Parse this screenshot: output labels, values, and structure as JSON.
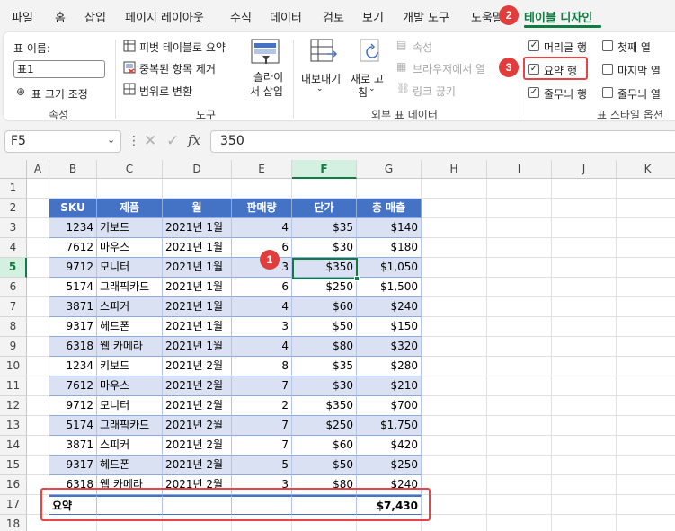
{
  "menu": {
    "tabs": [
      "파일",
      "홈",
      "삽입",
      "페이지 레이아웃",
      "수식",
      "데이터",
      "검토",
      "보기",
      "개발 도구",
      "도움말",
      "테이블 디자인"
    ],
    "active_tab": "테이블 디자인"
  },
  "ribbon": {
    "properties": {
      "table_name_label": "표 이름:",
      "table_name_value": "표1",
      "resize_label": "표 크기 조정",
      "group_label": "속성"
    },
    "tools": {
      "pivot_label": "피벗 테이블로 요약",
      "remove_duplicates_label": "중복된 항목 제거",
      "convert_range_label": "범위로 변환",
      "slicer_label_line1": "슬라이",
      "slicer_label_line2": "서 삽입",
      "group_label": "도구"
    },
    "external": {
      "export_label": "내보내기",
      "refresh_label_line1": "새로 고",
      "refresh_label_line2": "침",
      "properties_label": "속성",
      "open_browser_label": "브라우저에서 열",
      "unlink_label": "링크 끊기",
      "group_label": "외부 표 데이터"
    },
    "style_options": {
      "header_row_label": "머리글 행",
      "header_row_checked": true,
      "total_row_label": "요약 행",
      "total_row_checked": true,
      "banded_rows_label": "줄무늬 행",
      "banded_rows_checked": true,
      "first_col_label": "첫째 열",
      "first_col_checked": false,
      "last_col_label": "마지막 열",
      "last_col_checked": false,
      "banded_cols_label": "줄무늬 열",
      "banded_cols_checked": false,
      "group_label": "표 스타일 옵션"
    }
  },
  "formula_bar": {
    "name_box": "F5",
    "fx_label": "fx",
    "value": "350"
  },
  "sheet": {
    "columns": [
      "A",
      "B",
      "C",
      "D",
      "E",
      "F",
      "G",
      "H",
      "I",
      "J",
      "K"
    ],
    "selected_column": "F",
    "rows": [
      "1",
      "2",
      "3",
      "4",
      "5",
      "6",
      "7",
      "8",
      "9",
      "10",
      "11",
      "12",
      "13",
      "14",
      "15",
      "16",
      "17",
      "18"
    ],
    "selected_row": "5"
  },
  "table": {
    "headers": [
      "SKU",
      "제품",
      "월",
      "판매량",
      "단가",
      "총 매출"
    ],
    "rows": [
      [
        "1234",
        "키보드",
        "2021년 1월",
        "4",
        "$35",
        "$140"
      ],
      [
        "7612",
        "마우스",
        "2021년 1월",
        "6",
        "$30",
        "$180"
      ],
      [
        "9712",
        "모니터",
        "2021년 1월",
        "3",
        "$350",
        "$1,050"
      ],
      [
        "5174",
        "그래픽카드",
        "2021년 1월",
        "6",
        "$250",
        "$1,500"
      ],
      [
        "3871",
        "스피커",
        "2021년 1월",
        "4",
        "$60",
        "$240"
      ],
      [
        "9317",
        "헤드폰",
        "2021년 1월",
        "3",
        "$50",
        "$150"
      ],
      [
        "6318",
        "웹 카메라",
        "2021년 1월",
        "4",
        "$80",
        "$320"
      ],
      [
        "1234",
        "키보드",
        "2021년 2월",
        "8",
        "$35",
        "$280"
      ],
      [
        "7612",
        "마우스",
        "2021년 2월",
        "7",
        "$30",
        "$210"
      ],
      [
        "9712",
        "모니터",
        "2021년 2월",
        "2",
        "$350",
        "$700"
      ],
      [
        "5174",
        "그래픽카드",
        "2021년 2월",
        "7",
        "$250",
        "$1,750"
      ],
      [
        "3871",
        "스피커",
        "2021년 2월",
        "7",
        "$60",
        "$420"
      ],
      [
        "9317",
        "헤드폰",
        "2021년 2월",
        "5",
        "$50",
        "$250"
      ],
      [
        "6318",
        "웹 카메라",
        "2021년 2월",
        "3",
        "$80",
        "$240"
      ]
    ],
    "total_label": "요약",
    "total_value": "$7,430"
  },
  "callouts": [
    "1",
    "2",
    "3"
  ],
  "colors": {
    "accent": "#107c41",
    "table_header": "#4472c4",
    "table_band": "#d9e1f2",
    "callout": "#e23d3d"
  }
}
